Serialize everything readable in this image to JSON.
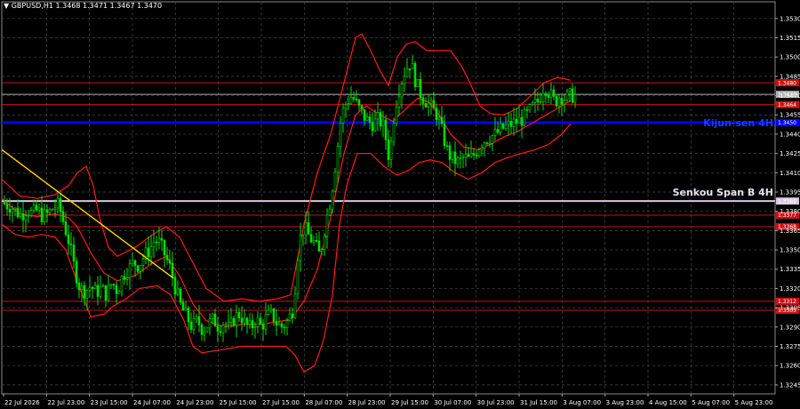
{
  "header": {
    "title": "▼ GBPUSD,H1  1.3468 1.3471 1.3467 1.3470"
  },
  "colors": {
    "background": "#000000",
    "grid": "#4a4a4a",
    "candle": "#00dd00",
    "bands": "#ff1a1a",
    "levels": "#cc1111",
    "kijun": "#0000ff",
    "senkou": "#d8c8e0",
    "trend": "#ffd400",
    "price_line": "#cccccc"
  },
  "chart_data": {
    "type": "candlestick",
    "ylim": [
      1.3238,
      1.3543
    ],
    "y_ticks": [
      "1.3530",
      "1.3515",
      "1.3500",
      "1.3485",
      "1.3470",
      "1.3455",
      "1.3440",
      "1.3425",
      "1.3410",
      "1.3395",
      "1.3380",
      "1.3365",
      "1.3350",
      "1.3335",
      "1.3320",
      "1.3305",
      "1.3290",
      "1.3275",
      "1.3260",
      "1.3245"
    ],
    "x_ticks": [
      "22 Jul 2026",
      "22 Jul 23:00",
      "23 Jul 15:00",
      "24 Jul 07:00",
      "24 Jul 23:00",
      "25 Jul 15:00",
      "27 Jul 15:00",
      "28 Jul 07:00",
      "28 Jul 23:00",
      "29 Jul 15:00",
      "30 Jul 07:00",
      "30 Jul 23:00",
      "31 Jul 15:00",
      "3 Aug 07:00",
      "3 Aug 23:00",
      "4 Aug 15:00",
      "5 Aug 07:00",
      "5 Aug 23:00"
    ],
    "levels": [
      {
        "label": "1.3480",
        "value": 1.348,
        "color": "#cc1111",
        "width": 1
      },
      {
        "label": "1.3470",
        "value": 1.3471,
        "color": "#b0b0b0",
        "width": 1
      },
      {
        "label": "1.3464",
        "value": 1.3463,
        "color": "#cc1111",
        "width": 1
      },
      {
        "label": "1.3450",
        "value": 1.3449,
        "color": "#0000ff",
        "width": 3
      },
      {
        "label": "1.3388",
        "value": 1.3388,
        "color": "#d8c8e0",
        "width": 2
      },
      {
        "label": "1.3377",
        "value": 1.3377,
        "color": "#cc1111",
        "width": 1
      },
      {
        "label": "1.3368",
        "value": 1.3368,
        "color": "#cc1111",
        "width": 1
      },
      {
        "label": "1.3312",
        "value": 1.331,
        "color": "#cc1111",
        "width": 1
      },
      {
        "label": "1.3305",
        "value": 1.3303,
        "color": "#cc1111",
        "width": 1
      }
    ],
    "annotations": [
      {
        "text": "Kijun-sen 4H",
        "value": 1.3449,
        "color": "#1a3cff"
      },
      {
        "text": "Senkou Span B 4H",
        "value": 1.3395,
        "color": "#e8e0f0"
      }
    ],
    "close_path": [
      [
        0,
        1.3387
      ],
      [
        5,
        1.3385
      ],
      [
        10,
        1.3384
      ],
      [
        16,
        1.338
      ],
      [
        22,
        1.3377
      ],
      [
        28,
        1.3382
      ],
      [
        34,
        1.3378
      ],
      [
        40,
        1.3381
      ],
      [
        46,
        1.3376
      ],
      [
        52,
        1.3378
      ],
      [
        58,
        1.3383
      ],
      [
        64,
        1.3385
      ],
      [
        70,
        1.337
      ],
      [
        76,
        1.3355
      ],
      [
        82,
        1.3335
      ],
      [
        88,
        1.332
      ],
      [
        94,
        1.3318
      ],
      [
        100,
        1.3322
      ],
      [
        106,
        1.3317
      ],
      [
        112,
        1.332
      ],
      [
        118,
        1.3315
      ],
      [
        124,
        1.3325
      ],
      [
        130,
        1.3318
      ],
      [
        136,
        1.333
      ],
      [
        142,
        1.3335
      ],
      [
        148,
        1.334
      ],
      [
        154,
        1.3338
      ],
      [
        160,
        1.3345
      ],
      [
        166,
        1.335
      ],
      [
        172,
        1.3358
      ],
      [
        178,
        1.3355
      ],
      [
        184,
        1.3345
      ],
      [
        190,
        1.3335
      ],
      [
        196,
        1.3318
      ],
      [
        202,
        1.3305
      ],
      [
        208,
        1.3298
      ],
      [
        214,
        1.329
      ],
      [
        220,
        1.3295
      ],
      [
        226,
        1.3288
      ],
      [
        232,
        1.3292
      ],
      [
        238,
        1.3296
      ],
      [
        244,
        1.329
      ],
      [
        250,
        1.3294
      ],
      [
        256,
        1.3288
      ],
      [
        262,
        1.3298
      ],
      [
        268,
        1.33
      ],
      [
        274,
        1.3292
      ],
      [
        280,
        1.3289
      ],
      [
        286,
        1.3296
      ],
      [
        292,
        1.329
      ],
      [
        298,
        1.3298
      ],
      [
        304,
        1.33
      ],
      [
        310,
        1.3292
      ],
      [
        316,
        1.329
      ],
      [
        322,
        1.3295
      ],
      [
        328,
        1.3305
      ],
      [
        334,
        1.3355
      ],
      [
        340,
        1.3368
      ],
      [
        346,
        1.336
      ],
      [
        352,
        1.3355
      ],
      [
        358,
        1.3345
      ],
      [
        364,
        1.337
      ],
      [
        370,
        1.339
      ],
      [
        376,
        1.342
      ],
      [
        382,
        1.3455
      ],
      [
        388,
        1.3465
      ],
      [
        394,
        1.347
      ],
      [
        400,
        1.3462
      ],
      [
        406,
        1.3455
      ],
      [
        412,
        1.345
      ],
      [
        418,
        1.3448
      ],
      [
        424,
        1.3452
      ],
      [
        430,
        1.3445
      ],
      [
        436,
        1.342
      ],
      [
        442,
        1.346
      ],
      [
        448,
        1.3478
      ],
      [
        454,
        1.349
      ],
      [
        460,
        1.3496
      ],
      [
        466,
        1.348
      ],
      [
        472,
        1.347
      ],
      [
        478,
        1.3465
      ],
      [
        484,
        1.346
      ],
      [
        490,
        1.3455
      ],
      [
        496,
        1.344
      ],
      [
        502,
        1.3425
      ],
      [
        508,
        1.342
      ],
      [
        514,
        1.3418
      ],
      [
        520,
        1.3422
      ],
      [
        526,
        1.342
      ],
      [
        532,
        1.3425
      ],
      [
        538,
        1.3432
      ],
      [
        544,
        1.3436
      ],
      [
        550,
        1.3438
      ],
      [
        556,
        1.344
      ],
      [
        562,
        1.3444
      ],
      [
        568,
        1.3446
      ],
      [
        574,
        1.3448
      ],
      [
        580,
        1.345
      ],
      [
        586,
        1.3452
      ],
      [
        592,
        1.3456
      ],
      [
        598,
        1.3462
      ],
      [
        604,
        1.3466
      ],
      [
        610,
        1.3478
      ],
      [
        616,
        1.3472
      ],
      [
        622,
        1.3465
      ],
      [
        628,
        1.347
      ],
      [
        634,
        1.3468
      ],
      [
        640,
        1.347
      ],
      [
        645,
        1.347
      ]
    ],
    "bands": {
      "upper": [
        [
          0,
          1.3405
        ],
        [
          20,
          1.3392
        ],
        [
          40,
          1.339
        ],
        [
          60,
          1.3393
        ],
        [
          75,
          1.34
        ],
        [
          85,
          1.341
        ],
        [
          95,
          1.3415
        ],
        [
          103,
          1.34
        ],
        [
          110,
          1.3375
        ],
        [
          120,
          1.3352
        ],
        [
          130,
          1.3345
        ],
        [
          150,
          1.3352
        ],
        [
          170,
          1.3362
        ],
        [
          185,
          1.3368
        ],
        [
          200,
          1.336
        ],
        [
          215,
          1.334
        ],
        [
          230,
          1.332
        ],
        [
          250,
          1.331
        ],
        [
          270,
          1.3312
        ],
        [
          290,
          1.331
        ],
        [
          310,
          1.3312
        ],
        [
          325,
          1.3315
        ],
        [
          340,
          1.337
        ],
        [
          355,
          1.341
        ],
        [
          370,
          1.344
        ],
        [
          385,
          1.348
        ],
        [
          398,
          1.3515
        ],
        [
          405,
          1.3518
        ],
        [
          415,
          1.3505
        ],
        [
          425,
          1.349
        ],
        [
          435,
          1.3478
        ],
        [
          445,
          1.35
        ],
        [
          455,
          1.351
        ],
        [
          465,
          1.3512
        ],
        [
          478,
          1.3505
        ],
        [
          490,
          1.3505
        ],
        [
          505,
          1.3505
        ],
        [
          518,
          1.3492
        ],
        [
          528,
          1.3478
        ],
        [
          538,
          1.3462
        ],
        [
          550,
          1.3456
        ],
        [
          565,
          1.3455
        ],
        [
          580,
          1.346
        ],
        [
          595,
          1.347
        ],
        [
          610,
          1.348
        ],
        [
          625,
          1.3484
        ],
        [
          640,
          1.3482
        ]
      ],
      "lower": [
        [
          0,
          1.337
        ],
        [
          15,
          1.3362
        ],
        [
          30,
          1.336
        ],
        [
          45,
          1.3362
        ],
        [
          60,
          1.336
        ],
        [
          72,
          1.335
        ],
        [
          85,
          1.3325
        ],
        [
          100,
          1.3298
        ],
        [
          115,
          1.33
        ],
        [
          125,
          1.3306
        ],
        [
          140,
          1.3312
        ],
        [
          155,
          1.332
        ],
        [
          175,
          1.3322
        ],
        [
          190,
          1.3315
        ],
        [
          205,
          1.3295
        ],
        [
          215,
          1.3275
        ],
        [
          225,
          1.327
        ],
        [
          245,
          1.3272
        ],
        [
          270,
          1.3275
        ],
        [
          295,
          1.3275
        ],
        [
          320,
          1.3275
        ],
        [
          330,
          1.3268
        ],
        [
          340,
          1.3255
        ],
        [
          352,
          1.326
        ],
        [
          362,
          1.328
        ],
        [
          372,
          1.3315
        ],
        [
          380,
          1.337
        ],
        [
          388,
          1.34
        ],
        [
          400,
          1.3425
        ],
        [
          415,
          1.3425
        ],
        [
          430,
          1.3415
        ],
        [
          445,
          1.3408
        ],
        [
          458,
          1.3412
        ],
        [
          470,
          1.3418
        ],
        [
          482,
          1.342
        ],
        [
          495,
          1.3418
        ],
        [
          510,
          1.341
        ],
        [
          525,
          1.3405
        ],
        [
          540,
          1.341
        ],
        [
          555,
          1.3418
        ],
        [
          570,
          1.3422
        ],
        [
          585,
          1.3425
        ],
        [
          600,
          1.3428
        ],
        [
          615,
          1.3432
        ],
        [
          630,
          1.344
        ],
        [
          640,
          1.3448
        ]
      ],
      "middle": [
        [
          0,
          1.339
        ],
        [
          20,
          1.3378
        ],
        [
          40,
          1.3376
        ],
        [
          60,
          1.3378
        ],
        [
          75,
          1.3375
        ],
        [
          85,
          1.3368
        ],
        [
          100,
          1.3348
        ],
        [
          115,
          1.3332
        ],
        [
          130,
          1.3326
        ],
        [
          150,
          1.333
        ],
        [
          170,
          1.334
        ],
        [
          185,
          1.3345
        ],
        [
          200,
          1.333
        ],
        [
          215,
          1.3308
        ],
        [
          230,
          1.3295
        ],
        [
          250,
          1.329
        ],
        [
          270,
          1.3292
        ],
        [
          290,
          1.3292
        ],
        [
          310,
          1.3294
        ],
        [
          325,
          1.3296
        ],
        [
          340,
          1.331
        ],
        [
          355,
          1.3335
        ],
        [
          370,
          1.3375
        ],
        [
          385,
          1.3425
        ],
        [
          398,
          1.3455
        ],
        [
          410,
          1.3462
        ],
        [
          425,
          1.3455
        ],
        [
          440,
          1.345
        ],
        [
          455,
          1.346
        ],
        [
          468,
          1.3468
        ],
        [
          480,
          1.3465
        ],
        [
          492,
          1.3455
        ],
        [
          505,
          1.344
        ],
        [
          520,
          1.343
        ],
        [
          535,
          1.3428
        ],
        [
          550,
          1.3432
        ],
        [
          565,
          1.3438
        ],
        [
          580,
          1.3442
        ],
        [
          595,
          1.3448
        ],
        [
          610,
          1.3454
        ],
        [
          625,
          1.346
        ],
        [
          640,
          1.3466
        ]
      ]
    },
    "trendline": {
      "from": [
        0,
        1.3428
      ],
      "to": [
        193,
        1.3328
      ]
    }
  }
}
